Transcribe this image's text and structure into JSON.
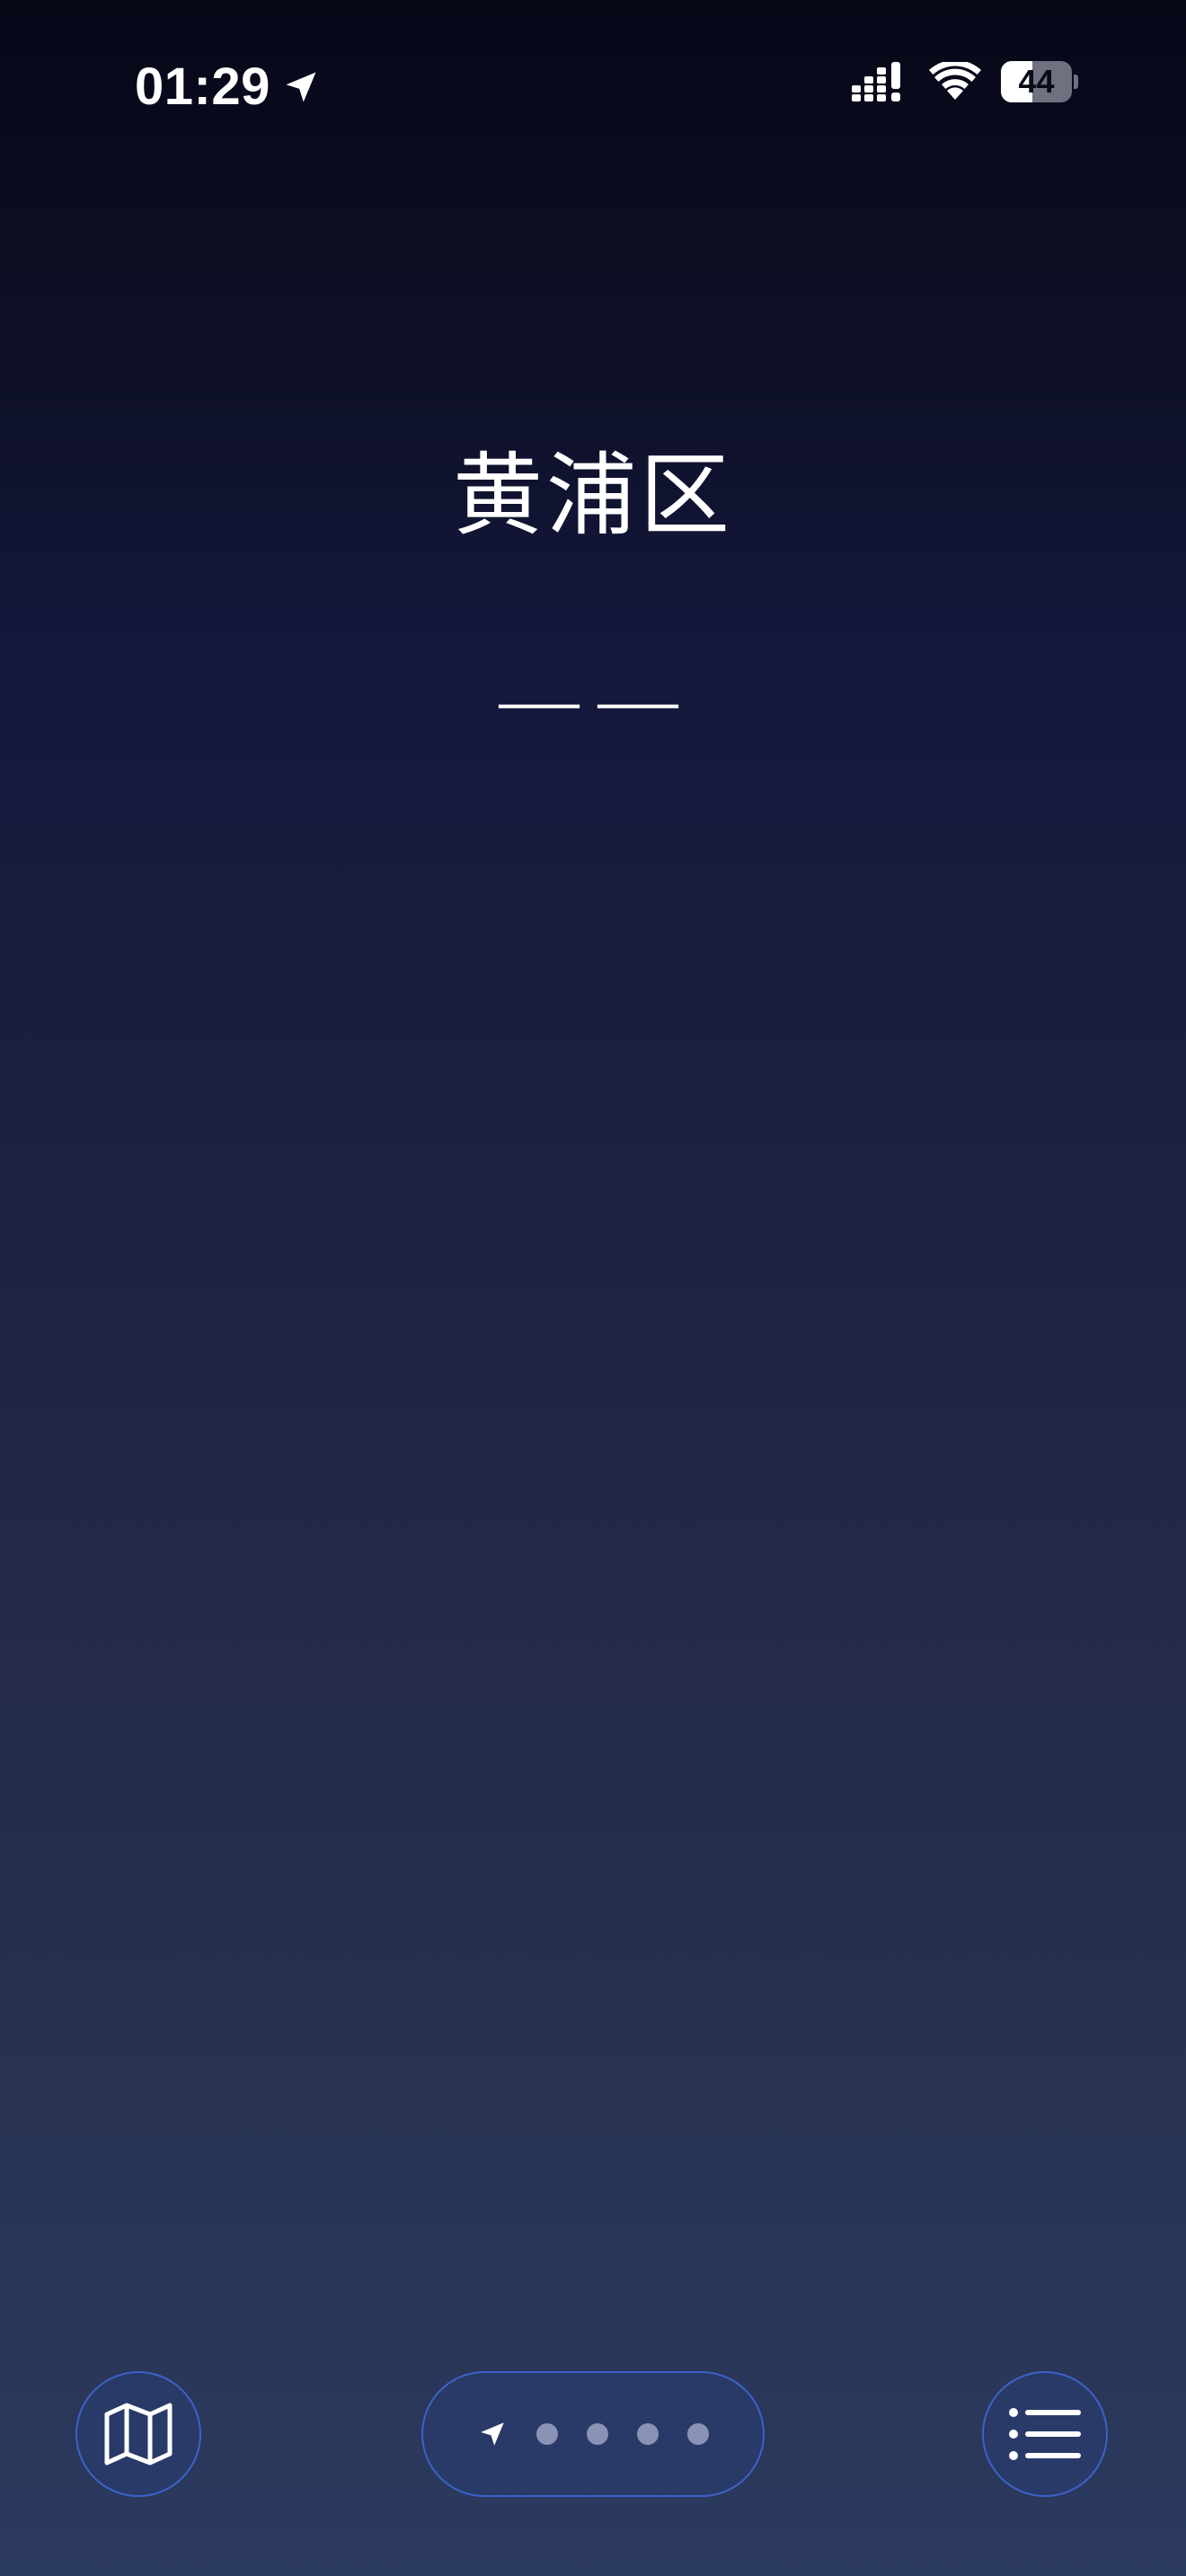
{
  "status_bar": {
    "time": "01:29",
    "battery_level": "44",
    "battery_fraction": 0.44,
    "icons": [
      "location-arrow-icon",
      "cellular-signal-icon",
      "wifi-icon",
      "battery-icon"
    ]
  },
  "main": {
    "location_name": "黄浦区",
    "temperature": "——"
  },
  "toolbar": {
    "map_icon": "map-icon",
    "list_icon": "list-icon",
    "pages": {
      "current_icon": "location-arrow-icon",
      "total_pages": 5,
      "current_page": 1
    }
  },
  "colors": {
    "background_top": "#060818",
    "background_bottom": "#2b3a5f",
    "button_border": "#3d62c9",
    "dot_inactive": "#8a93b4",
    "text": "#ffffff"
  }
}
